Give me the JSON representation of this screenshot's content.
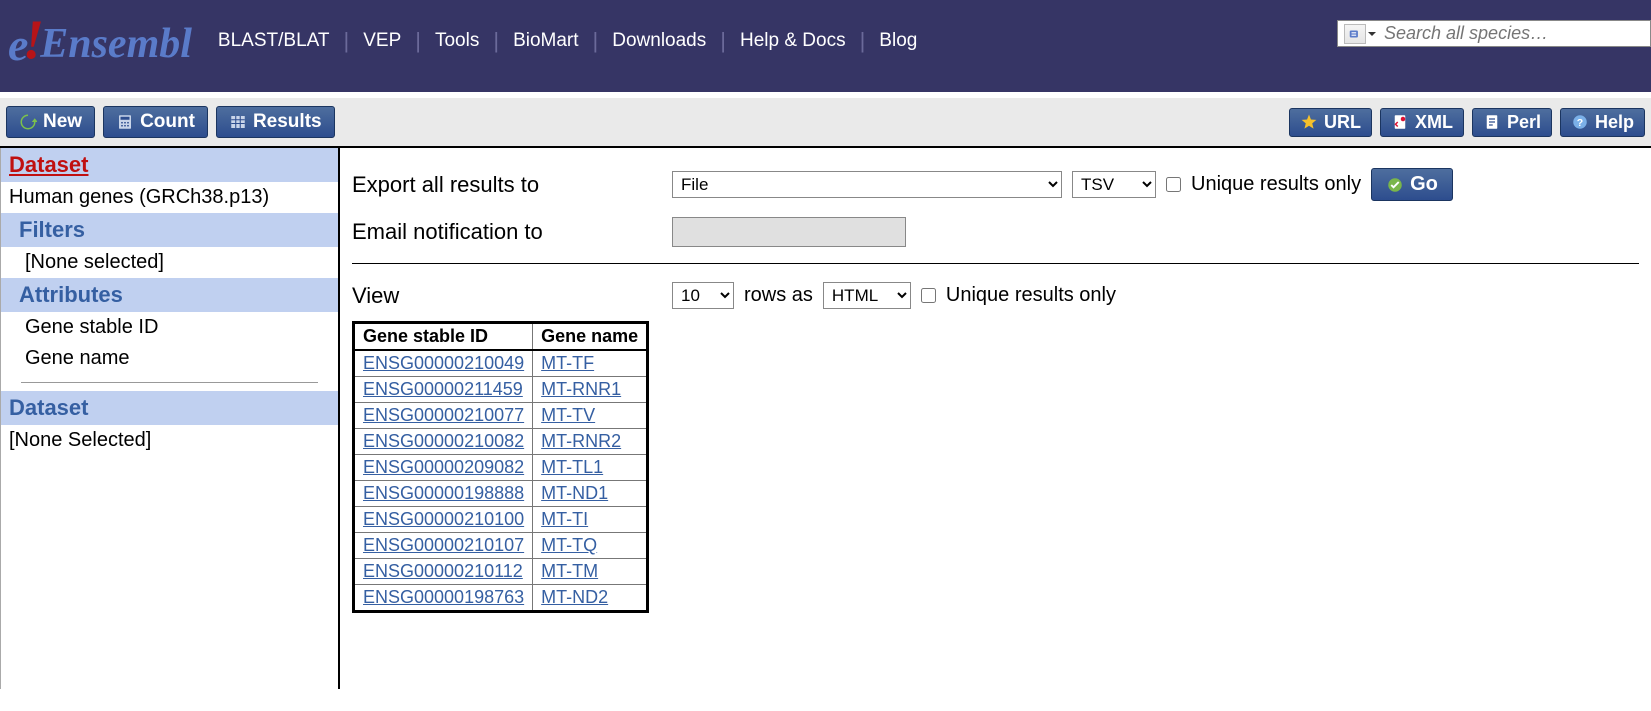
{
  "brand": "Ensembl",
  "nav": [
    "BLAST/BLAT",
    "VEP",
    "Tools",
    "BioMart",
    "Downloads",
    "Help & Docs",
    "Blog"
  ],
  "search": {
    "placeholder": "Search all species…"
  },
  "toolbar": {
    "new": "New",
    "count": "Count",
    "results": "Results",
    "url": "URL",
    "xml": "XML",
    "perl": "Perl",
    "help": "Help"
  },
  "sidebar": {
    "dataset_head": "Dataset",
    "dataset_value": "Human genes (GRCh38.p13)",
    "filters_head": "Filters",
    "filters_value": "[None selected]",
    "attributes_head": "Attributes",
    "attributes": [
      "Gene stable ID",
      "Gene name"
    ],
    "dataset2_head": "Dataset",
    "dataset2_value": "[None Selected]"
  },
  "export": {
    "label": "Export  all results to",
    "target_selected": "File",
    "format_selected": "TSV",
    "unique_label": "Unique results only",
    "email_label": "Email notification to",
    "go": "Go"
  },
  "view": {
    "label": "View",
    "rows_selected": "10",
    "rows_as": "rows as",
    "as_selected": "HTML",
    "unique_label": "Unique results only"
  },
  "table": {
    "headers": [
      "Gene stable ID",
      "Gene name"
    ],
    "rows": [
      {
        "id": "ENSG00000210049",
        "name": "MT-TF"
      },
      {
        "id": "ENSG00000211459",
        "name": "MT-RNR1"
      },
      {
        "id": "ENSG00000210077",
        "name": "MT-TV"
      },
      {
        "id": "ENSG00000210082",
        "name": "MT-RNR2"
      },
      {
        "id": "ENSG00000209082",
        "name": "MT-TL1"
      },
      {
        "id": "ENSG00000198888",
        "name": "MT-ND1"
      },
      {
        "id": "ENSG00000210100",
        "name": "MT-TI"
      },
      {
        "id": "ENSG00000210107",
        "name": "MT-TQ"
      },
      {
        "id": "ENSG00000210112",
        "name": "MT-TM"
      },
      {
        "id": "ENSG00000198763",
        "name": "MT-ND2"
      }
    ]
  }
}
